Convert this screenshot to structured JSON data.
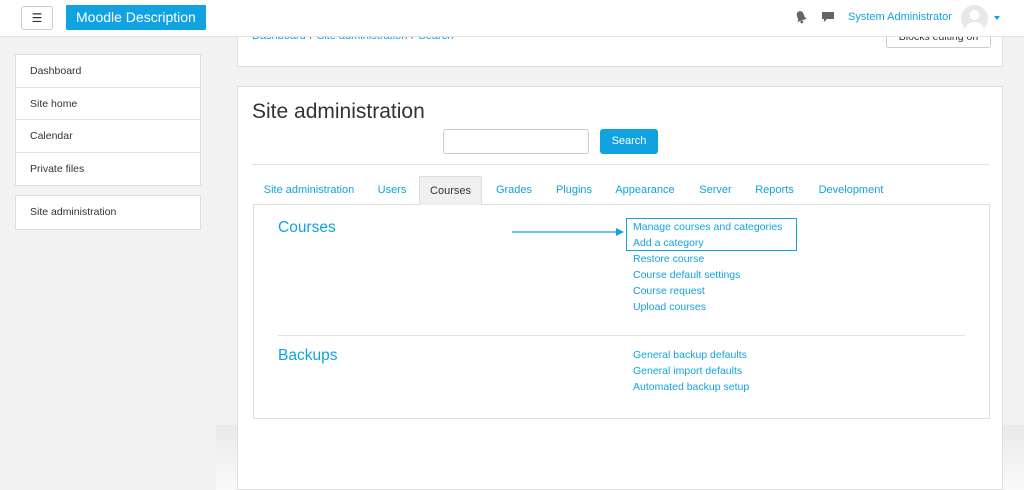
{
  "navbar": {
    "menu_icon": "☰",
    "brand": "Moodle Description",
    "user_name": "System Administrator",
    "icons": [
      "bell-icon",
      "message-icon",
      "avatar",
      "chevron-down-icon"
    ]
  },
  "sidebar": {
    "nav_items": [
      "Dashboard",
      "Site home",
      "Calendar",
      "Private files"
    ],
    "admin_item": "Site administration"
  },
  "breadcrumb": [
    "Dashboard",
    "Site administration",
    "Search"
  ],
  "blocks_button": "Blocks editing on",
  "page_title": "Site administration",
  "search": {
    "value": "",
    "placeholder": "",
    "button": "Search"
  },
  "tabs": [
    {
      "label": "Site administration",
      "active": false
    },
    {
      "label": "Users",
      "active": false
    },
    {
      "label": "Courses",
      "active": true
    },
    {
      "label": "Grades",
      "active": false
    },
    {
      "label": "Plugins",
      "active": false
    },
    {
      "label": "Appearance",
      "active": false
    },
    {
      "label": "Server",
      "active": false
    },
    {
      "label": "Reports",
      "active": false
    },
    {
      "label": "Development",
      "active": false
    }
  ],
  "sections": [
    {
      "title": "Courses",
      "links": [
        "Manage courses and categories",
        "Add a category",
        "Restore course",
        "Course default settings",
        "Course request",
        "Upload courses"
      ]
    },
    {
      "title": "Backups",
      "links": [
        "General backup defaults",
        "General import defaults",
        "Automated backup setup"
      ]
    }
  ],
  "colors": {
    "accent": "#10a3e0",
    "background": "#f2f2f2"
  }
}
